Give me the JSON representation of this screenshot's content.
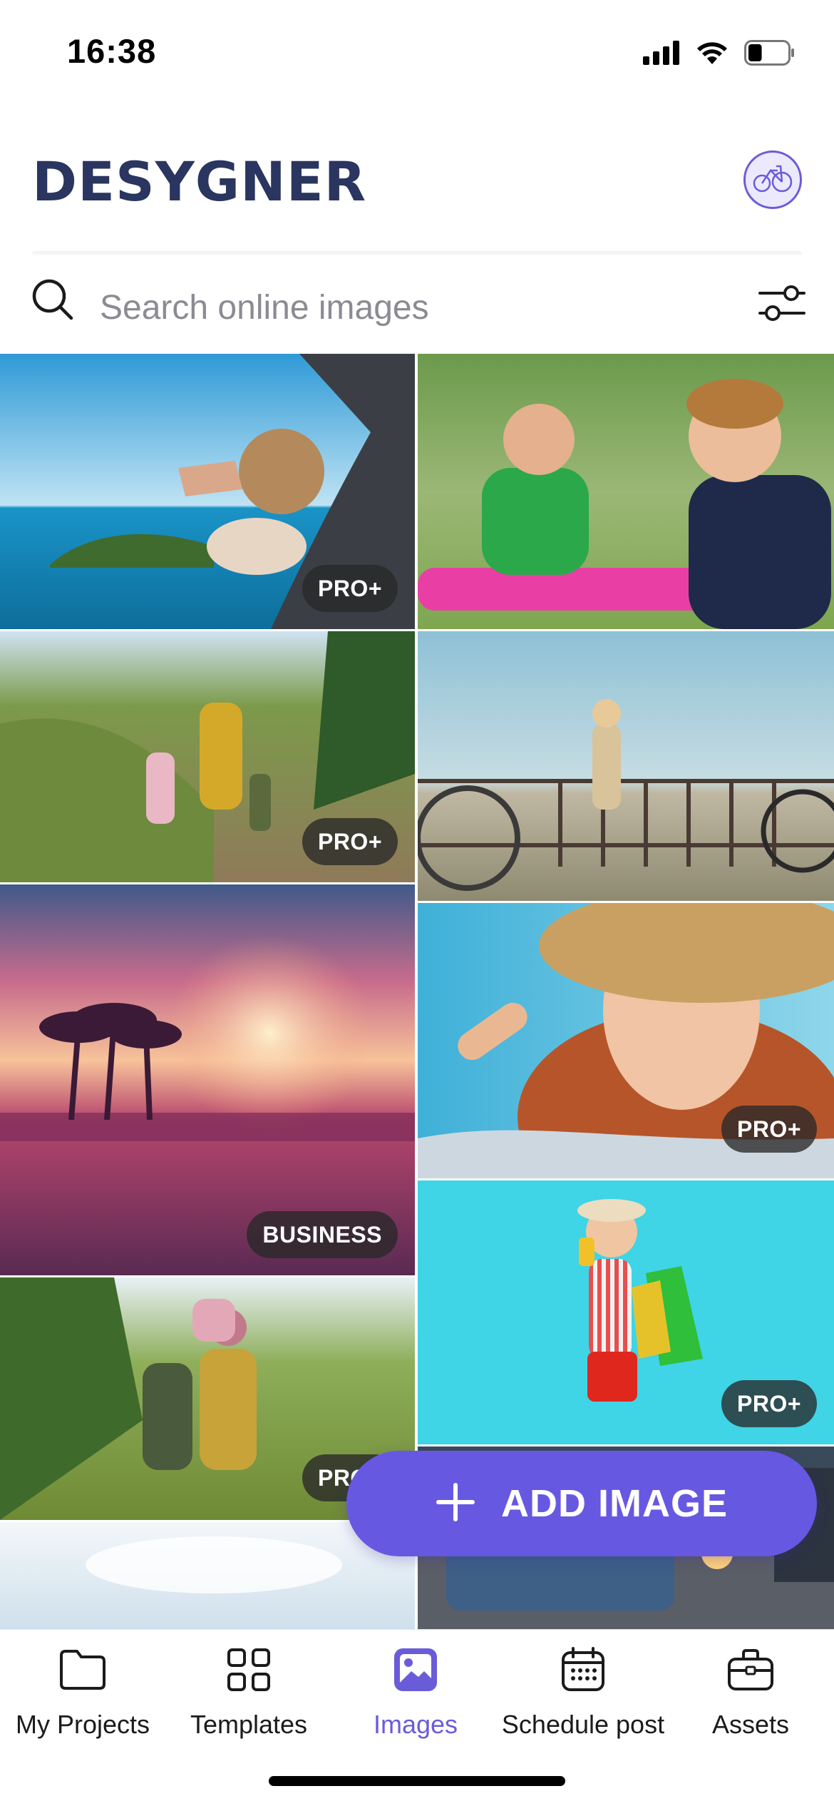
{
  "status_bar": {
    "time": "16:38",
    "battery_level": 0.35
  },
  "header": {
    "brand": "DESYGNER",
    "avatar_icon": "bicycle-logo-icon"
  },
  "search": {
    "placeholder": "Search online images",
    "value": ""
  },
  "images": [
    {
      "id": "beach-car-window",
      "badge": "PRO+"
    },
    {
      "id": "two-boys-pool",
      "badge": ""
    },
    {
      "id": "family-hiking",
      "badge": "PRO+"
    },
    {
      "id": "girl-bicycles-seaside",
      "badge": ""
    },
    {
      "id": "pink-sunset-palms",
      "badge": "BUSINESS"
    },
    {
      "id": "woman-straw-hat",
      "badge": "PRO+"
    },
    {
      "id": "family-meadow",
      "badge": "PRO+"
    },
    {
      "id": "woman-shopping-bags",
      "badge": "PRO+"
    },
    {
      "id": "beach-sky",
      "badge": ""
    },
    {
      "id": "patio-evening",
      "badge": ""
    }
  ],
  "fab": {
    "label": "ADD IMAGE",
    "icon": "plus-icon"
  },
  "nav": {
    "items": [
      {
        "label": "My Projects",
        "icon": "folder-icon",
        "active": false
      },
      {
        "label": "Templates",
        "icon": "grid-icon",
        "active": false
      },
      {
        "label": "Images",
        "icon": "image-icon",
        "active": true
      },
      {
        "label": "Schedule post",
        "icon": "calendar-icon",
        "active": false
      },
      {
        "label": "Assets",
        "icon": "briefcase-icon",
        "active": false
      }
    ]
  },
  "colors": {
    "brand": "#2a3560",
    "accent": "#6758e2",
    "active_nav": "#6a5cd8",
    "badge_bg": "#2b2b2b"
  }
}
